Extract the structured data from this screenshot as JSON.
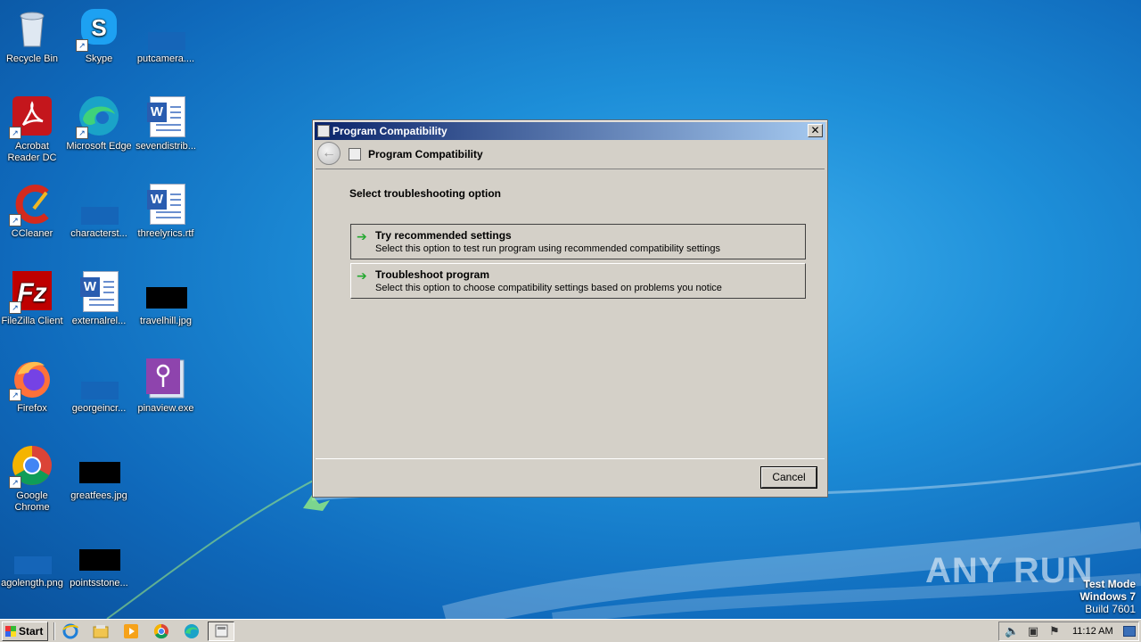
{
  "desktop": {
    "icons": [
      {
        "label": "Recycle Bin"
      },
      {
        "label": "Skype"
      },
      {
        "label": "putcamera...."
      },
      {
        "label": "Acrobat\nReader DC"
      },
      {
        "label": "Microsoft Edge"
      },
      {
        "label": "sevendistrib..."
      },
      {
        "label": "CCleaner"
      },
      {
        "label": "characterst..."
      },
      {
        "label": "threelyrics.rtf"
      },
      {
        "label": "FileZilla Client"
      },
      {
        "label": "externalrel..."
      },
      {
        "label": "travelhill.jpg"
      },
      {
        "label": "Firefox"
      },
      {
        "label": "georgeincr..."
      },
      {
        "label": "pinaview.exe"
      },
      {
        "label": "Google\nChrome"
      },
      {
        "label": "greatfees.jpg"
      },
      {
        "label": "agolength.png"
      },
      {
        "label": "pointsstone..."
      }
    ]
  },
  "dialog": {
    "window_title": "Program Compatibility",
    "nav_title": "Program Compatibility",
    "heading": "Select troubleshooting option",
    "options": [
      {
        "title": "Try recommended settings",
        "description": "Select this option to test run program using recommended compatibility settings"
      },
      {
        "title": "Troubleshoot program",
        "description": "Select this option to choose compatibility settings based on problems you notice"
      }
    ],
    "cancel_label": "Cancel",
    "close_glyph": "✕",
    "back_glyph": "←"
  },
  "watermark": {
    "text": "ANY RUN"
  },
  "testmode": {
    "line1": "Test Mode",
    "line2": "Windows 7",
    "line3": "Build 7601"
  },
  "taskbar": {
    "start_label": "Start",
    "pinned": [
      "internet-explorer-icon",
      "file-explorer-icon",
      "media-player-icon",
      "chrome-icon",
      "edge-icon"
    ],
    "clock": "11:12 AM"
  },
  "colors": {
    "accent": "#0a246a",
    "desktop": "#1d8ed8",
    "arrow": "#24a830"
  }
}
